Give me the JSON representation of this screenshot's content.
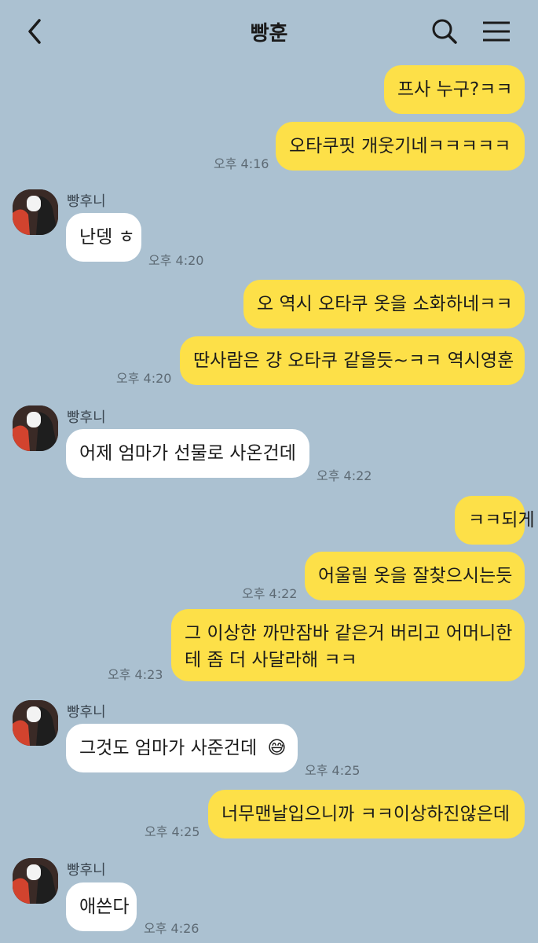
{
  "header": {
    "title": "빵훈"
  },
  "colors": {
    "background": "#abc1d1",
    "my_bubble": "#fde048",
    "their_bubble": "#ffffff"
  },
  "messages": [
    {
      "text": "프사 누구?ㅋㅋ",
      "time": ""
    },
    {
      "text": "오타쿠핏 개웃기네ㅋㅋㅋㅋㅋ",
      "time": "오후 4:16"
    },
    {
      "sender": "빵후니",
      "text": "난뎅 ㅎ",
      "time": "오후 4:20"
    },
    {
      "text": "오 역시 오타쿠 옷을 소화하네ㅋㅋ",
      "time": ""
    },
    {
      "text": "딴사람은 걍 오타쿠 같을듯~ㅋㅋ 역시영훈",
      "time": "오후 4:20"
    },
    {
      "sender": "빵후니",
      "text": "어제 엄마가 선물로 사온건데",
      "time": "오후 4:22"
    },
    {
      "text": "ㅋㅋ되게",
      "time": ""
    },
    {
      "text": "어울릴 옷을 잘찾으시는듯",
      "time": "오후 4:22"
    },
    {
      "text_line1": "그 이상한 까만잠바 같은거 버리고 어머니한",
      "text_line2": "테 좀 더 사달라해 ㅋㅋ",
      "time": "오후 4:23"
    },
    {
      "sender": "빵후니",
      "text": "그것도 엄마가 사준건데",
      "emoji": "😅",
      "time": "오후 4:25"
    },
    {
      "text": "너무맨날입으니까 ㅋㅋ이상하진않은데",
      "time": "오후 4:25"
    },
    {
      "sender": "빵후니",
      "text": "애쓴다",
      "time": "오후 4:26"
    }
  ]
}
